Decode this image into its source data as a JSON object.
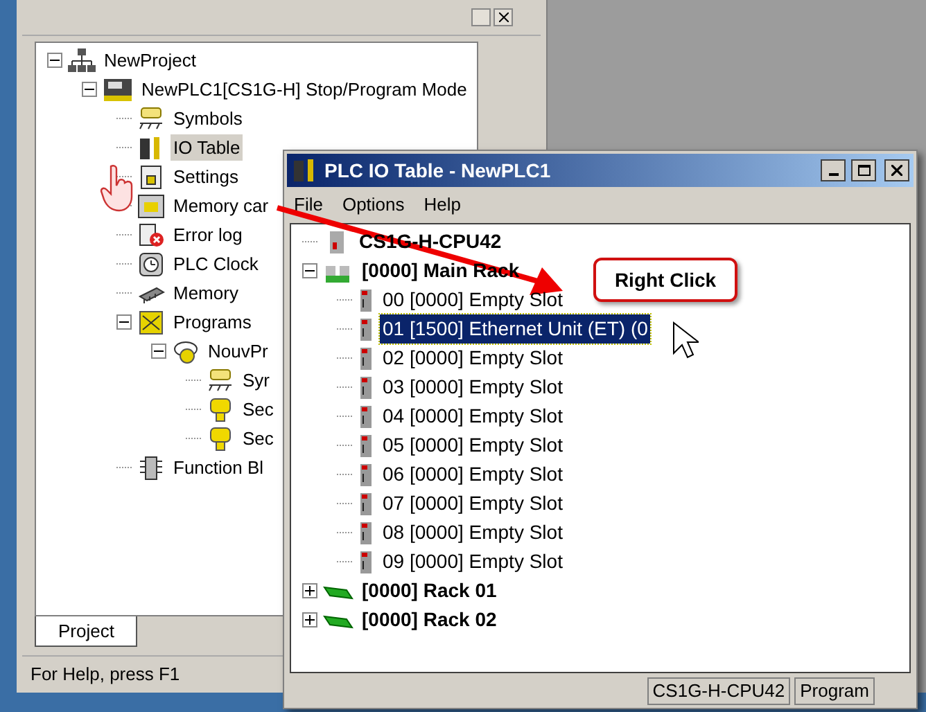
{
  "main_window": {
    "tree": [
      {
        "label": "NewProject",
        "kind": "project",
        "selected": false,
        "expanded": true,
        "children": [
          {
            "label": "NewPLC1[CS1G-H] Stop/Program Mode",
            "kind": "plc",
            "selected": false,
            "expanded": true,
            "children": [
              {
                "label": "Symbols",
                "kind": "symbols",
                "selected": false
              },
              {
                "label": "IO Table",
                "kind": "io",
                "selected": true
              },
              {
                "label": "Settings",
                "kind": "settings",
                "selected": false
              },
              {
                "label": "Memory car",
                "kind": "card",
                "selected": false
              },
              {
                "label": "Error log",
                "kind": "error",
                "selected": false
              },
              {
                "label": "PLC Clock",
                "kind": "clock",
                "selected": false
              },
              {
                "label": "Memory",
                "kind": "memory",
                "selected": false
              },
              {
                "label": "Programs",
                "kind": "programs",
                "selected": false,
                "expanded": true,
                "children": [
                  {
                    "label": "NouvPr",
                    "kind": "task",
                    "selected": false,
                    "expanded": true,
                    "children": [
                      {
                        "label": "Syr",
                        "kind": "symbols",
                        "selected": false
                      },
                      {
                        "label": "Sec",
                        "kind": "section",
                        "selected": false
                      },
                      {
                        "label": "Sec",
                        "kind": "section",
                        "selected": false
                      }
                    ]
                  }
                ]
              },
              {
                "label": "Function Bl",
                "kind": "block",
                "selected": false
              }
            ]
          }
        ]
      }
    ],
    "tab": {
      "label": "Project",
      "selected": true
    },
    "status_bar": "For Help, press F1"
  },
  "io_window": {
    "title": "PLC IO Table - NewPLC1",
    "menu": [
      "File",
      "Options",
      "Help"
    ],
    "tree": [
      {
        "label": "CS1G-H-CPU42",
        "kind": "cpu",
        "selected": false
      },
      {
        "label": "[0000] Main Rack",
        "kind": "rack",
        "selected": false,
        "expanded": true,
        "children": [
          {
            "label": "00 [0000] Empty Slot",
            "kind": "slot",
            "selected": false
          },
          {
            "label": "01 [1500] Ethernet Unit (ET) (0",
            "kind": "slot",
            "selected": true
          },
          {
            "label": "02 [0000] Empty Slot",
            "kind": "slot",
            "selected": false
          },
          {
            "label": "03 [0000] Empty Slot",
            "kind": "slot",
            "selected": false
          },
          {
            "label": "04 [0000] Empty Slot",
            "kind": "slot",
            "selected": false
          },
          {
            "label": "05 [0000] Empty Slot",
            "kind": "slot",
            "selected": false
          },
          {
            "label": "06 [0000] Empty Slot",
            "kind": "slot",
            "selected": false
          },
          {
            "label": "07 [0000] Empty Slot",
            "kind": "slot",
            "selected": false
          },
          {
            "label": "08 [0000] Empty Slot",
            "kind": "slot",
            "selected": false
          },
          {
            "label": "09 [0000] Empty Slot",
            "kind": "slot",
            "selected": false
          }
        ]
      },
      {
        "label": "[0000] Rack 01",
        "kind": "board",
        "selected": false,
        "expanded": false
      },
      {
        "label": "[0000] Rack 02",
        "kind": "board",
        "selected": false,
        "expanded": false
      }
    ],
    "status_bar": [
      "CS1G-H-CPU42",
      "Program"
    ]
  },
  "callout": "Right Click"
}
